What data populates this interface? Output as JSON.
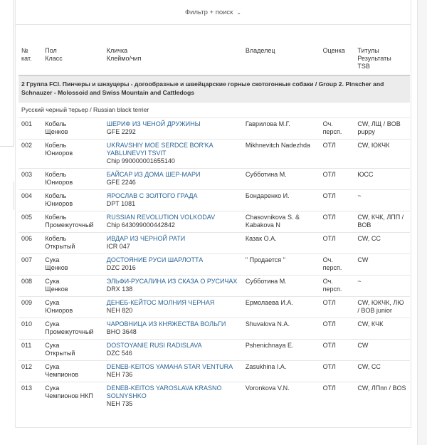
{
  "filter": {
    "label": "Фильтр + поиск",
    "icon": "chevron-down-icon"
  },
  "columns": {
    "num": [
      "№",
      "кат."
    ],
    "sex_class": [
      "Пол",
      "Класс"
    ],
    "name": [
      "Кличка",
      "Клеймо/чип"
    ],
    "owner": "Владелец",
    "grade": "Оценка",
    "titles": [
      "Титулы",
      "Результаты",
      "TSB"
    ]
  },
  "group_title": "2 Группа FCI. Пинчеры и шнауцеры - догообразные и швейцарские горные скотогонные собаки / Group 2. Pinscher and Schnauzer - Molossoid and Swiss Mountain and Cattledogs",
  "breed_title": "Русский черный терьер / Russian black terrier",
  "rows": [
    {
      "num": "001",
      "sex": "Кобель",
      "cls": "Щенков",
      "name": "ШЕРИФ ИЗ ЧЕНОЙ ДРУЖИНЫ",
      "chip": "GFE 2292",
      "owner": "Гаврилова М.Г.",
      "grade": "Оч. персп.",
      "titles": "CW, ЛЩ / BOB puppy"
    },
    {
      "num": "002",
      "sex": "Кобель",
      "cls": "Юниоров",
      "name": "UKRAVSHIY MOE SERDCE BOR'KA YABLUNEVYI TSVIT",
      "chip": "Chip 990000001655140",
      "owner": "Mikhnevitch Nadezhda",
      "grade": "ОТЛ",
      "titles": "CW, ЮКЧК"
    },
    {
      "num": "003",
      "sex": "Кобель",
      "cls": "Юниоров",
      "name": "БАЙСАР ИЗ ДОМА ШЕР-МАРИ",
      "chip": "GFE 2246",
      "owner": "Субботина М.",
      "grade": "ОТЛ",
      "titles": "ЮСС"
    },
    {
      "num": "004",
      "sex": "Кобель",
      "cls": "Юниоров",
      "name": "ЯРОСЛАВ С ЗОЛТОГО ГРАДА",
      "chip": "DPT 1081",
      "owner": "Бондаренко И.",
      "grade": "ОТЛ",
      "titles": "~"
    },
    {
      "num": "005",
      "sex": "Кобель",
      "cls": "Промежуточный",
      "name": "RUSSIAN REVOLUTION VOLKODAV",
      "chip": "Chip 643099000442842",
      "owner": "Chasovnikova S. & Kabakova N",
      "grade": "ОТЛ",
      "titles": "CW, КЧК, ЛПП / BOB"
    },
    {
      "num": "006",
      "sex": "Кобель",
      "cls": "Открытый",
      "name": "ИВДАР ИЗ ЧЕРНОЙ РАТИ",
      "chip": "ICR 047",
      "owner": "Казак О.А.",
      "grade": "ОТЛ",
      "titles": "CW, CC"
    },
    {
      "num": "007",
      "sex": "Сука",
      "cls": "Щенков",
      "name": "ДОСТОЯНИЕ РУСИ ШАРЛОТТА",
      "chip": "DZC 2016",
      "owner": "\" Продается \"",
      "grade": "Оч. персп.",
      "titles": "CW"
    },
    {
      "num": "008",
      "sex": "Сука",
      "cls": "Щенков",
      "name": "ЭЛЬФИ-РУСАЛИНА ИЗ СКАЗА О РУСИЧАХ",
      "chip": "DRX 138",
      "owner": "Субботина М.",
      "grade": "Оч. персп.",
      "titles": "~"
    },
    {
      "num": "009",
      "sex": "Сука",
      "cls": "Юниоров",
      "name": "ДЕНЕБ-КЕЙТОС МОЛНИЯ ЧЕРНАЯ",
      "chip": "NEH 820",
      "owner": "Ермолаева И.А.",
      "grade": "ОТЛ",
      "titles": "CW, ЮКЧК, ЛЮ / BOB junior"
    },
    {
      "num": "010",
      "sex": "Сука",
      "cls": "Промежуточный",
      "name": "ЧАРОВНИЦА ИЗ КНЯЖЕСТВА ВОЛЬГИ",
      "chip": "BHO 3648",
      "owner": "Shuvalova N.A.",
      "grade": "ОТЛ",
      "titles": "CW, КЧК"
    },
    {
      "num": "011",
      "sex": "Сука",
      "cls": "Открытый",
      "name": "DOSTOYANIE RUSI RADISLAVA",
      "chip": "DZC 546",
      "owner": "Pshenichnaya E.",
      "grade": "ОТЛ",
      "titles": "CW"
    },
    {
      "num": "012",
      "sex": "Сука",
      "cls": "Чемпионов",
      "name": "DENEB-KEITOS YAMAHA STAR VENTURA",
      "chip": "NEH 736",
      "owner": "Zasukhina I.A.",
      "grade": "ОТЛ",
      "titles": "CW, CC"
    },
    {
      "num": "013",
      "sex": "Сука",
      "cls": "Чемпионов НКП",
      "name": "DENEB-KEITOS YAROSLAVA KRASNO SOLNYSHKO",
      "chip": "NEH 735",
      "owner": "Voronkova V.N.",
      "grade": "ОТЛ",
      "titles": "CW, ЛПпп / BOS"
    }
  ]
}
